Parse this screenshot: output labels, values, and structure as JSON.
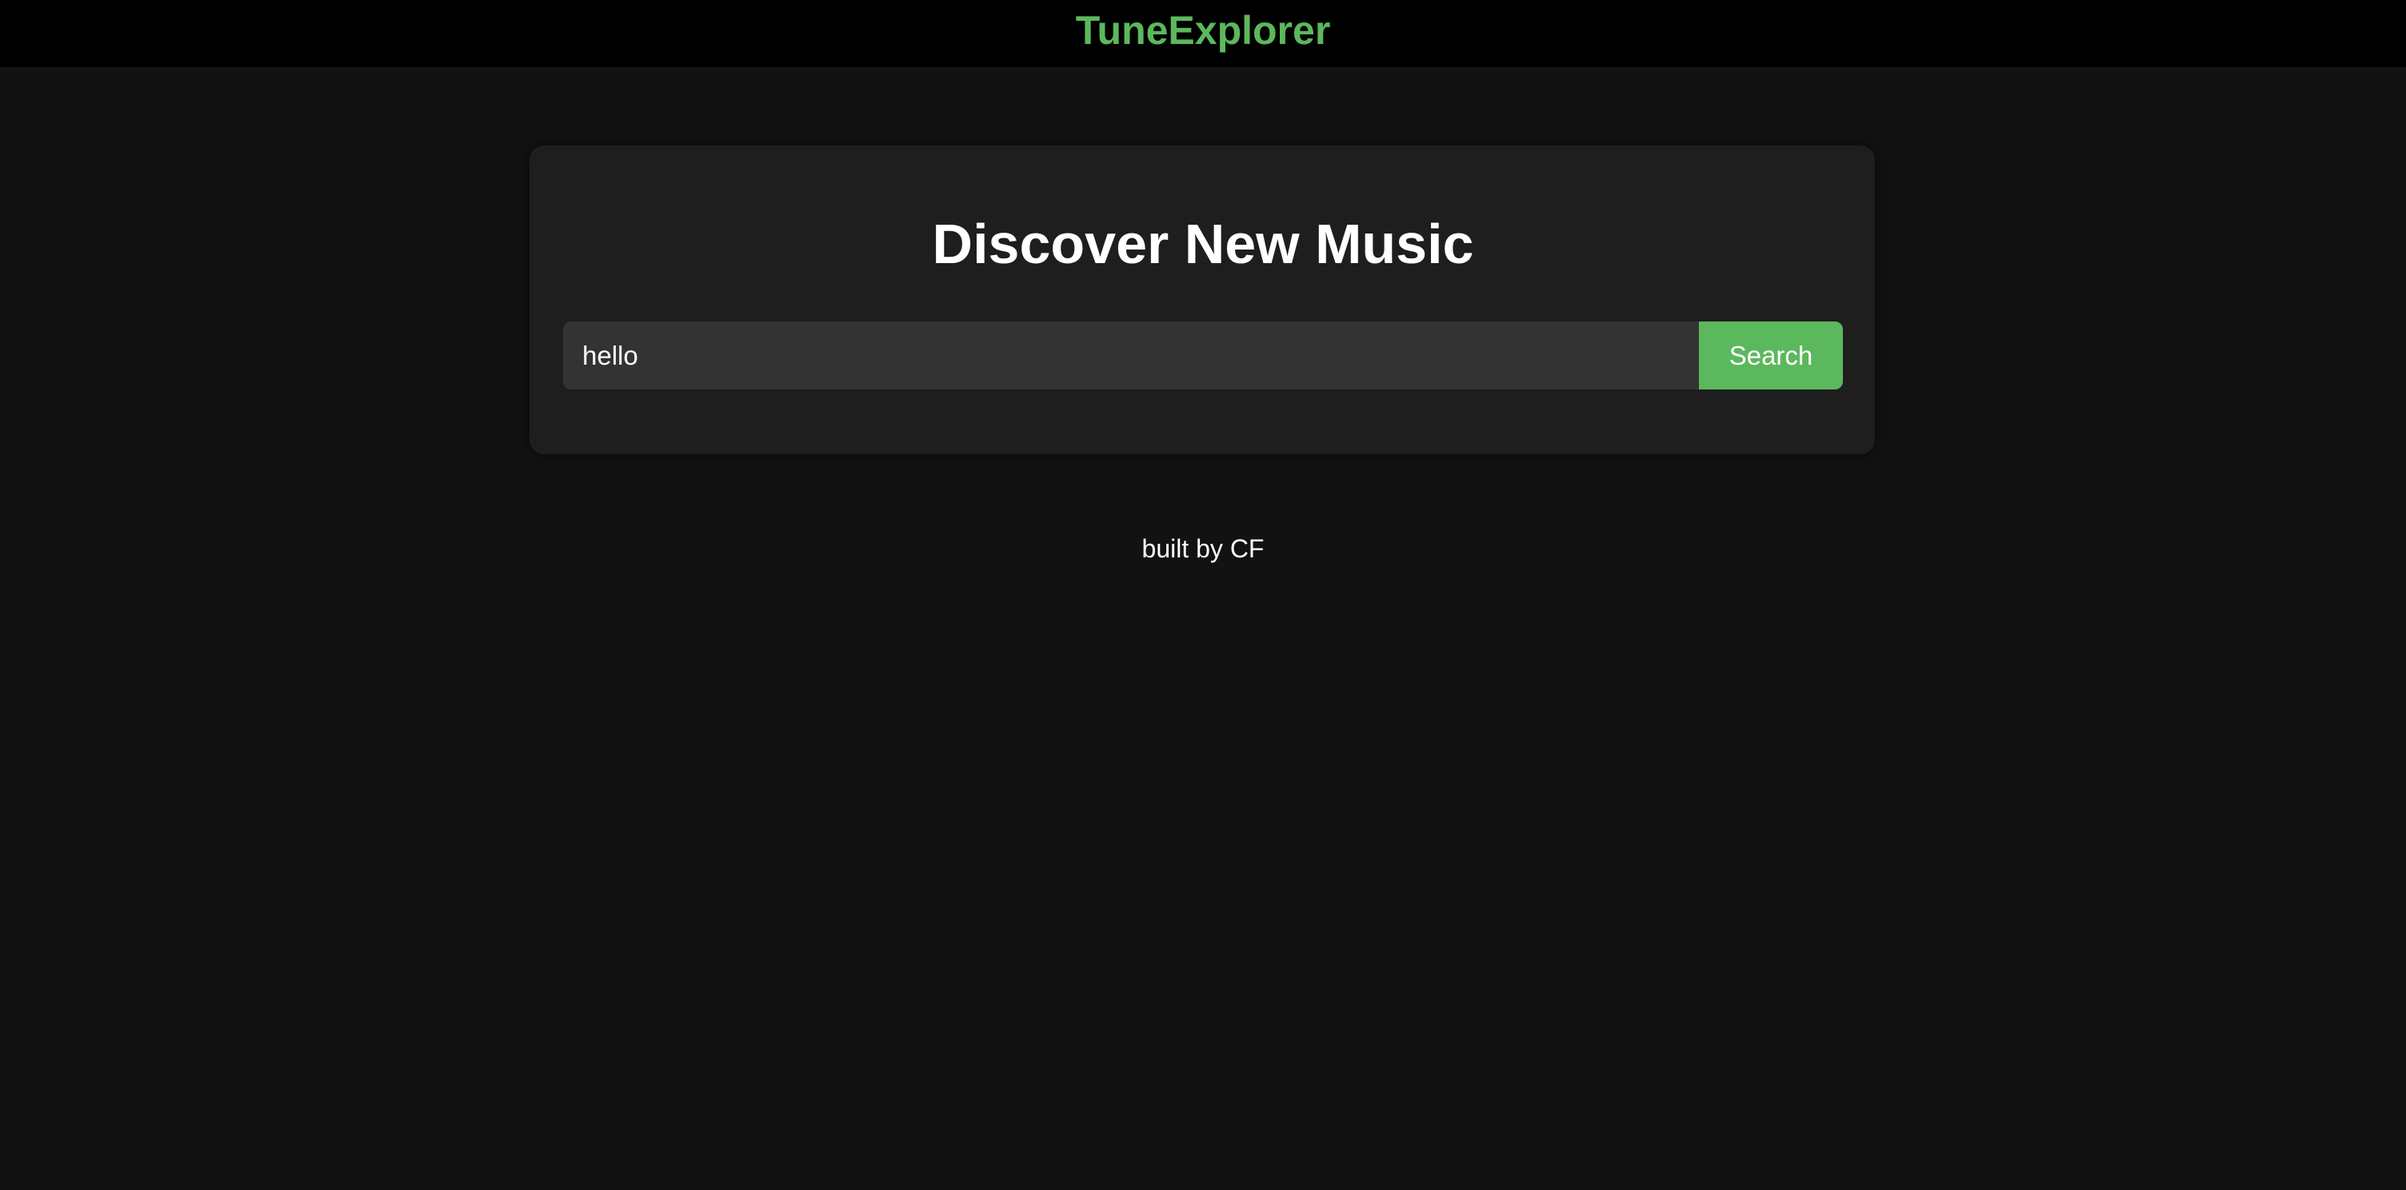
{
  "header": {
    "brand": "TuneExplorer"
  },
  "main": {
    "title": "Discover New Music",
    "search": {
      "value": "hello",
      "button_label": "Search"
    }
  },
  "footer": {
    "text": "built by CF"
  },
  "colors": {
    "accent": "#5cb85c",
    "background": "#121212",
    "card": "#1e1e1e",
    "input": "#333333",
    "topbar": "#000000"
  }
}
